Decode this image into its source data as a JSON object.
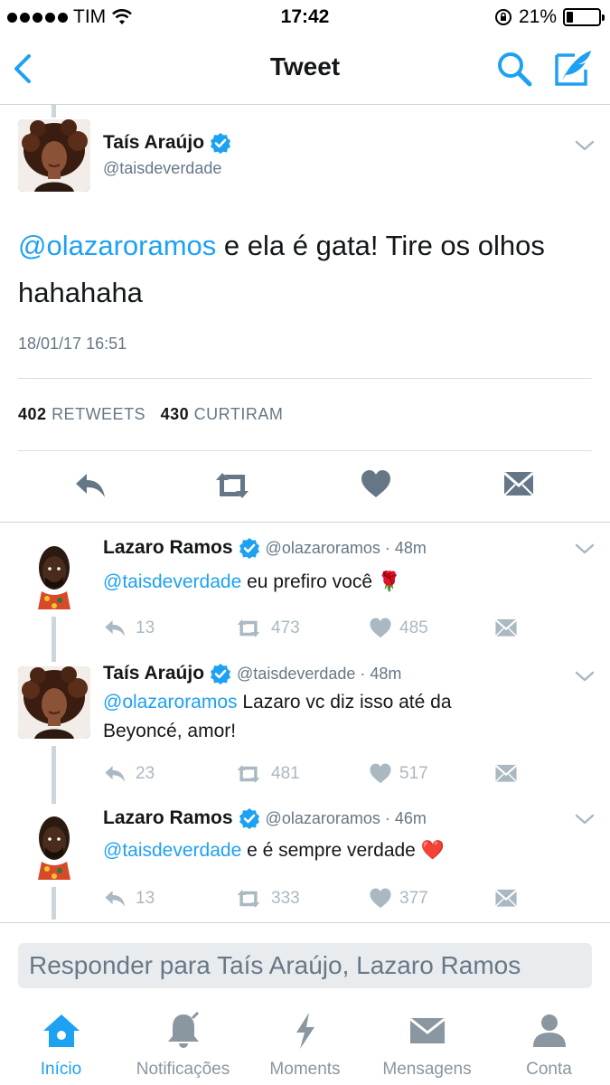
{
  "status_bar": {
    "carrier": "TIM",
    "time": "17:42",
    "battery": "21%",
    "battery_level": 0.21
  },
  "nav": {
    "title": "Tweet",
    "icons": [
      "back-icon",
      "search-icon",
      "compose-icon"
    ]
  },
  "main_tweet": {
    "name": "Taís Araújo",
    "handle": "@taisdeverdade",
    "mention": "@olazaroramos",
    "text": " e ela é gata! Tire os olhos hahahaha",
    "date": "18/01/17 16:51",
    "retweets_count": "402",
    "retweets_label": "RETWEETS",
    "likes_count": "430",
    "likes_label": "CURTIRAM"
  },
  "replies": [
    {
      "name": "Lazaro Ramos",
      "meta": "@olazaroramos · 48m",
      "mention": "@taisdeverdade",
      "text": " eu prefiro você 🌹",
      "replies": "13",
      "retweets": "473",
      "likes": "485"
    },
    {
      "name": "Taís Araújo",
      "meta": "@taisdeverdade · 48m",
      "mention": "@olazaroramos",
      "text": " Lazaro vc diz isso até da Beyoncé, amor!",
      "replies": "23",
      "retweets": "481",
      "likes": "517"
    },
    {
      "name": "Lazaro Ramos",
      "meta": "@olazaroramos · 46m",
      "mention": "@taisdeverdade",
      "text": " e é sempre verdade ❤️",
      "replies": "13",
      "retweets": "333",
      "likes": "377"
    }
  ],
  "reply_bar": {
    "placeholder": "Responder para Taís Araújo, Lazaro Ramos"
  },
  "tabs": [
    {
      "label": "Início",
      "icon": "home-icon",
      "active": true
    },
    {
      "label": "Notificações",
      "icon": "bell-icon",
      "active": false
    },
    {
      "label": "Moments",
      "icon": "lightning-icon",
      "active": false
    },
    {
      "label": "Mensagens",
      "icon": "envelope-icon",
      "active": false
    },
    {
      "label": "Conta",
      "icon": "person-icon",
      "active": false
    }
  ],
  "colors": {
    "accent": "#1da1f2",
    "muted": "#657786",
    "icon_gray": "#aab8c2"
  }
}
